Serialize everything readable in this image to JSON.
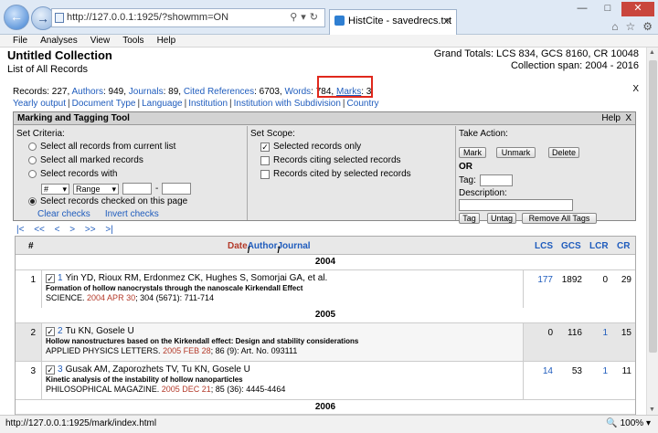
{
  "browser": {
    "url": "http://127.0.0.1:1925/?showmm=ON",
    "tab_title": "HistCite - savedrecs.txt",
    "status_url": "http://127.0.0.1:1925/mark/index.html",
    "zoom": "100%"
  },
  "menu": [
    "File",
    "Analyses",
    "View",
    "Tools",
    "Help"
  ],
  "header": {
    "collection_title": "Untitled Collection",
    "list_title": "List of All Records",
    "grand_totals": "Grand Totals: LCS 834, GCS 8160, CR 10048",
    "collection_span": "Collection span: 2004 - 2016"
  },
  "stats": {
    "records_prefix": "Records: 227, ",
    "authors_link": "Authors",
    "authors_val": ": 949, ",
    "journals_link": "Journals",
    "journals_val": ": 89, ",
    "cited_link": "Cited References",
    "cited_val": ": 6703, ",
    "words_link": "Words",
    "words_val": ": 784, ",
    "marks_link": "Marks",
    "marks_val": ": 3",
    "row2": [
      "Yearly output",
      "Document Type",
      "Language",
      "Institution",
      "Institution with Subdivision",
      "Country"
    ]
  },
  "tool": {
    "title": "Marking and Tagging Tool",
    "help": "Help",
    "close": "X",
    "criteria_header": "Set Criteria:",
    "criteria": [
      "Select all records from current list",
      "Select all marked records",
      "Select records with",
      "Select records checked on this page"
    ],
    "field_select": "#",
    "range_select": "Range",
    "dash": "-",
    "clear_checks": "Clear checks",
    "invert_checks": "Invert checks",
    "scope_header": "Set Scope:",
    "scope": [
      "Selected records only",
      "Records citing selected records",
      "Records cited by selected records"
    ],
    "action_header": "Take Action:",
    "mark": "Mark",
    "unmark": "Unmark",
    "delete": "Delete",
    "or": "OR",
    "tag_label": "Tag:",
    "desc_label": "Description:",
    "tag_btn": "Tag",
    "untag_btn": "Untag",
    "remove_tags_btn": "Remove All Tags"
  },
  "pager": "|<  <<  <   >  >>  >|",
  "table": {
    "col_num": "#",
    "col_date": "Date",
    "col_sep": " / ",
    "col_author": "Author",
    "col_journal": "Journal",
    "col_lcs": "LCS",
    "col_gcs": "GCS",
    "col_lcr": "LCR",
    "col_cr": "CR",
    "groups": [
      {
        "year": "2004",
        "records": [
          {
            "num": "1",
            "idx": "1",
            "authors": "Yin YD, Rioux RM, Erdonmez CK, Hughes S, Somorjai GA, et al.",
            "title": "Formation of hollow nanocrystals through the nanoscale Kirkendall Effect",
            "journal": "SCIENCE.",
            "date": "2004 APR 30",
            "cite": "; 304 (5671): 711-714",
            "lcs": "177",
            "gcs": "1892",
            "lcr": "0",
            "cr": "29"
          }
        ]
      },
      {
        "year": "2005",
        "records": [
          {
            "num": "2",
            "idx": "2",
            "authors": "Tu KN, Gosele U",
            "title": "Hollow nanostructures based on the Kirkendall effect: Design and stability considerations",
            "journal": "APPLIED PHYSICS LETTERS.",
            "date": "2005 FEB 28",
            "cite": "; 86 (9): Art. No. 093111",
            "lcs": "0",
            "gcs": "116",
            "lcr": "1",
            "cr": "15"
          },
          {
            "num": "3",
            "idx": "3",
            "authors": "Gusak AM, Zaporozhets TV, Tu KN, Gosele U",
            "title": "Kinetic analysis of the instability of hollow nanoparticles",
            "journal": "PHILOSOPHICAL MAGAZINE.",
            "date": "2005 DEC 21",
            "cite": "; 85 (36): 4445-4464",
            "lcs": "14",
            "gcs": "53",
            "lcr": "1",
            "cr": "11"
          }
        ]
      },
      {
        "year": "2006",
        "records": []
      }
    ]
  }
}
